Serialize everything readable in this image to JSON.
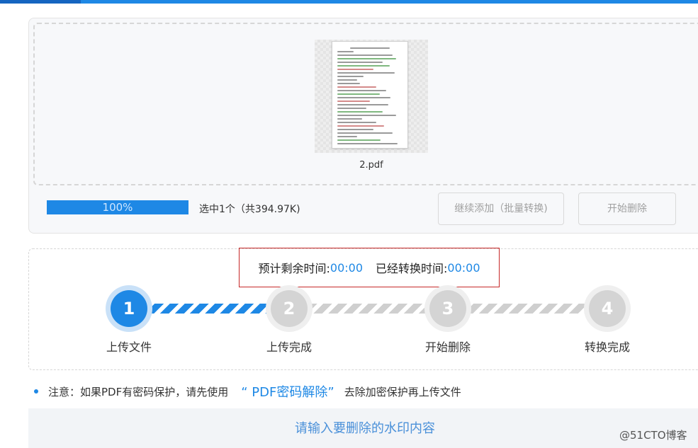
{
  "colors": {
    "accent": "#1e88e5",
    "highlight_box": "#c62828",
    "inactive": "#d4d4d4"
  },
  "upload": {
    "file_name": "2.pdf",
    "progress_percent": 100,
    "progress_label": "100%",
    "selection_info": "选中1个（共394.97K)",
    "continue_button": "继续添加（批量转换)",
    "start_button": "开始删除"
  },
  "timer": {
    "remaining_label": "预计剩余时间:",
    "remaining_value": "00:00",
    "elapsed_label": "已经转换时间:",
    "elapsed_value": "00:00"
  },
  "steps": [
    {
      "number": "1",
      "label": "上传文件",
      "active": true
    },
    {
      "number": "2",
      "label": "上传完成",
      "active": false
    },
    {
      "number": "3",
      "label": "开始删除",
      "active": false
    },
    {
      "number": "4",
      "label": "转换完成",
      "active": false
    }
  ],
  "notice": {
    "prefix": "注意：如果PDF有密码保护，请先使用",
    "link": "“ PDF密码解除”",
    "suffix": "去除加密保护再上传文件"
  },
  "watermark": {
    "placeholder": "请输入要删除的水印内容"
  },
  "brand": "@51CTO博客"
}
